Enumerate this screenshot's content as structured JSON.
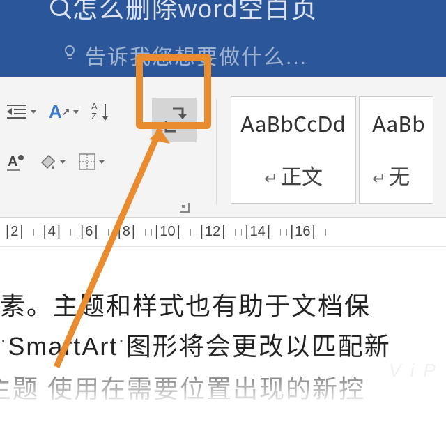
{
  "titlebar": {
    "partial_title": "怎么删除word空白页"
  },
  "tell_me": {
    "placeholder": "告诉我您想要做什么..."
  },
  "ribbon": {
    "paragraph_group": {
      "indent_label": "indent",
      "font_effects_label": "A",
      "sort_label": "AZ↓",
      "show_formatting_label": "show-formatting",
      "shading_label": "shading",
      "borders_label": "borders"
    },
    "styles": [
      {
        "preview": "AaBbCcDd",
        "name": "正文"
      },
      {
        "preview": "AaBb",
        "name": "无"
      }
    ]
  },
  "ruler": {
    "marks": [
      "2",
      "4",
      "6",
      "8",
      "10",
      "12",
      "14",
      "16"
    ]
  },
  "document": {
    "line1": "需元素。主题和样式也有助于文档保",
    "line2": "或 SmartArt 图形将会更改以匹配新",
    "line3": "的主题   使用在需要位置出现的新控"
  }
}
